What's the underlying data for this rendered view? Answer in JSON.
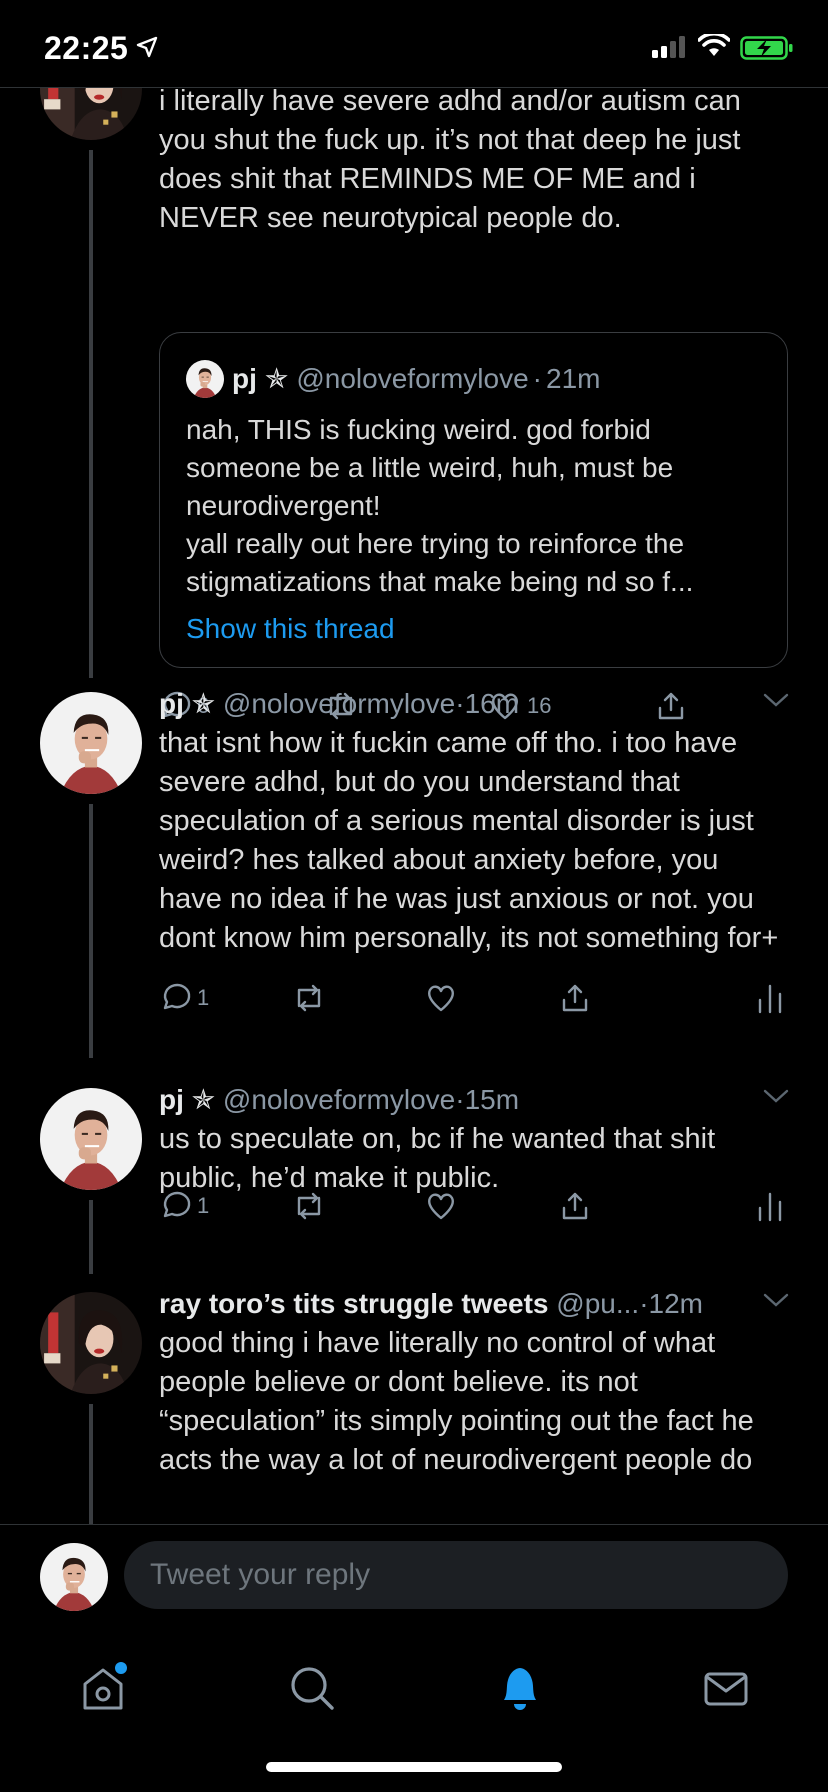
{
  "status_bar": {
    "time": "22:25",
    "battery_color": "#32d74b"
  },
  "tweets": [
    {
      "id": "tweet-1",
      "text": "i literally have severe adhd and/or autism can you shut the fuck up. it’s not that deep he just does shit that REMINDS ME OF ME and i NEVER see neurotypical people do.",
      "quote": {
        "name": "pj",
        "badge": "✯",
        "handle": "@noloveformylove",
        "sep": "·",
        "time": "21m",
        "text_lines": [
          "nah, THIS is fucking weird. god forbid",
          "someone be a little weird, huh, must be",
          "neurodivergent!",
          "yall really out here trying to reinforce the",
          "stigmatizations that make being nd so f..."
        ],
        "link": "Show this thread"
      },
      "actions": {
        "replies": "6",
        "likes": "16"
      }
    },
    {
      "id": "tweet-2",
      "name": "pj",
      "badge": "✯",
      "handle": "@noloveformylove",
      "sep": "·",
      "time": "16m",
      "text": "that isnt how it fuckin came off tho. i too have severe adhd, but do you understand that speculation of a serious mental disorder is just weird? hes talked about anxiety before, you have no idea if he was just anxious or not. you dont know him personally, its not something for+",
      "actions": {
        "replies": "1"
      }
    },
    {
      "id": "tweet-3",
      "name": "pj",
      "badge": "✯",
      "handle": "@noloveformylove",
      "sep": "·",
      "time": "15m",
      "text": "us to speculate on, bc if he wanted that shit public, he’d make it public.",
      "actions": {
        "replies": "1"
      }
    },
    {
      "id": "tweet-4",
      "name": "ray toro’s tits struggle tweets",
      "handle": "@pu...",
      "sep": "·",
      "time": "12m",
      "text": "good thing i have literally no control of what people believe or dont believe. its not “speculation” its simply pointing out the fact he acts the way a lot of neurodivergent people do"
    }
  ],
  "reply_bar": {
    "placeholder": "Tweet your reply"
  },
  "tab_bar": {
    "items": [
      {
        "icon": "home-icon",
        "active": false,
        "has_dot": true
      },
      {
        "icon": "search-icon",
        "active": false
      },
      {
        "icon": "notifications-bell-icon",
        "active": true
      },
      {
        "icon": "messages-envelope-icon",
        "active": false
      }
    ],
    "accent_color": "#1d9bf0"
  }
}
